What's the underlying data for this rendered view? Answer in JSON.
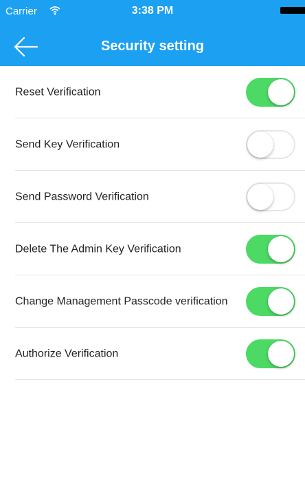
{
  "status_bar": {
    "carrier": "Carrier",
    "wifi_icon": "wifi-icon",
    "time": "3:38 PM",
    "battery_icon": "battery-icon"
  },
  "nav": {
    "back_icon": "back-arrow-icon",
    "title": "Security setting"
  },
  "colors": {
    "header_bg": "#1ba0f2",
    "toggle_on": "#4cd964",
    "toggle_off_border": "#e6e6e6"
  },
  "settings": [
    {
      "label": "Reset Verification",
      "enabled": true
    },
    {
      "label": "Send Key Verification",
      "enabled": false
    },
    {
      "label": "Send Password Verification",
      "enabled": false
    },
    {
      "label": "Delete The Admin Key Verification",
      "enabled": true
    },
    {
      "label": "Change Management Passcode verification",
      "enabled": true
    },
    {
      "label": "Authorize Verification",
      "enabled": true
    }
  ]
}
